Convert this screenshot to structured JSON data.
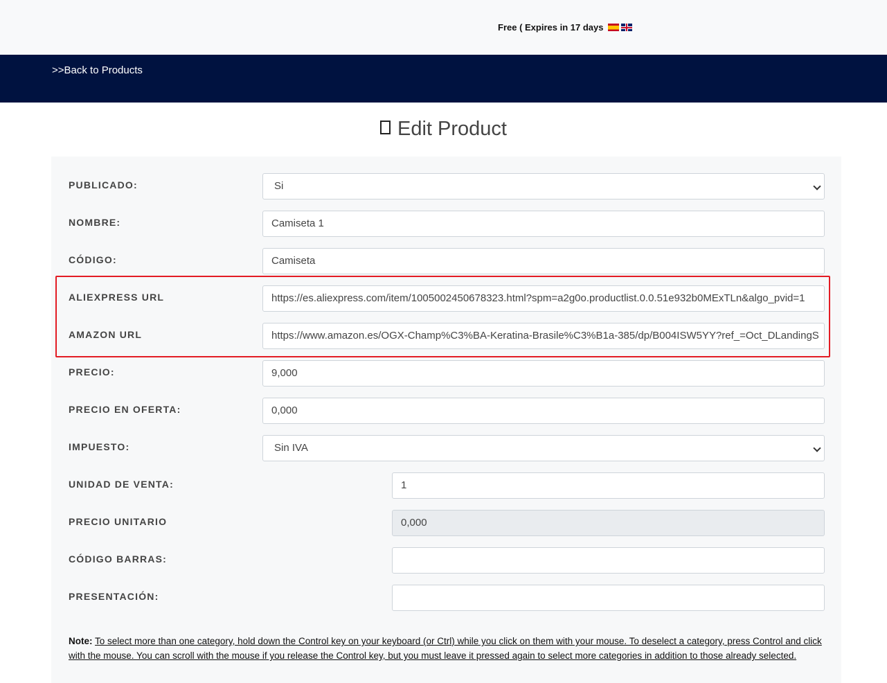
{
  "header": {
    "plan_text": "Free ( Expires in 17 days",
    "languages": [
      {
        "name": "spanish-flag-icon",
        "colors": [
          "#c60b1e",
          "#ffc400"
        ]
      },
      {
        "name": "uk-flag-icon",
        "colors": [
          "#012169",
          "#ffffff",
          "#c8102e"
        ]
      }
    ]
  },
  "nav": {
    "back_label": ">>Back to Products",
    "background": "#001240"
  },
  "page": {
    "title_icon": "edit-icon",
    "title": "Edit Product"
  },
  "form": {
    "publicado": {
      "label": "PUBLICADO:",
      "value": "Si"
    },
    "nombre": {
      "label": "NOMBRE:",
      "value": "Camiseta 1"
    },
    "codigo": {
      "label": "CÓDIGO:",
      "value": "Camiseta"
    },
    "aliexpress": {
      "label": "ALIEXPRESS URL",
      "value": "https://es.aliexpress.com/item/1005002450678323.html?spm=a2g0o.productlist.0.0.51e932b0MExTLn&algo_pvid=1"
    },
    "amazon": {
      "label": "AMAZON URL",
      "value": "https://www.amazon.es/OGX-Champ%C3%BA-Keratina-Brasile%C3%B1a-385/dp/B004ISW5YY?ref_=Oct_DLandingS"
    },
    "precio": {
      "label": "PRECIO:",
      "value": "9,000"
    },
    "precio_oferta": {
      "label": "PRECIO EN OFERTA:",
      "value": "0,000"
    },
    "impuesto": {
      "label": "IMPUESTO:",
      "value": "Sin IVA"
    },
    "unidad_venta": {
      "label": "UNIDAD DE VENTA:",
      "value": "1"
    },
    "precio_unitario": {
      "label": "PRECIO UNITARIO",
      "value": "0,000"
    },
    "codigo_barras": {
      "label": "CÓDIGO BARRAS:",
      "value": ""
    },
    "presentacion": {
      "label": "PRESENTACIÓN:",
      "value": ""
    }
  },
  "note": {
    "prefix": "Note:",
    "text": "To select more than one category, hold down the Control key on your keyboard (or Ctrl) while you click on them with your mouse. To deselect a category, press Control and click with the mouse. You can scroll with the mouse if you release the Control key, but you must leave it pressed again to select more categories in addition to those already selected."
  },
  "highlight_color": "#e31b23"
}
